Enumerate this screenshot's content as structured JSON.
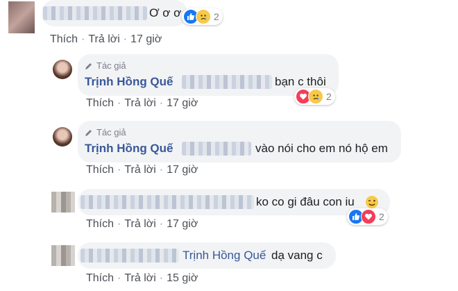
{
  "comments": [
    {
      "text": "Ơ ơ ơ",
      "reaction_count": "2",
      "reactions": [
        "like-icon",
        "sad-icon"
      ],
      "actions": {
        "like": "Thích",
        "reply": "Trả lời",
        "time": "17 giờ"
      }
    },
    {
      "badge": "Tác giả",
      "author": "Trịnh Hồng Quế",
      "text_suffix": "bạn c thôi",
      "reaction_count": "2",
      "reactions": [
        "love-icon",
        "sad-icon"
      ],
      "actions": {
        "like": "Thích",
        "reply": "Trả lời",
        "time": "17 giờ"
      }
    },
    {
      "badge": "Tác giả",
      "author": "Trịnh Hồng Quế",
      "text_suffix": "vào nói cho em nó hộ em",
      "actions": {
        "like": "Thích",
        "reply": "Trả lời",
        "time": "17 giờ"
      }
    },
    {
      "text": "ko co gi đâu con iu",
      "reaction_count": "2",
      "reactions": [
        "like-icon",
        "love-icon"
      ],
      "actions": {
        "like": "Thích",
        "reply": "Trả lời",
        "time": "17 giờ"
      }
    },
    {
      "mention": "Trịnh Hồng Quế",
      "text": "dạ vang c",
      "actions": {
        "like": "Thích",
        "reply": "Trả lời",
        "time": "15 giờ"
      }
    }
  ],
  "separator": "·",
  "colors": {
    "link": "#385898",
    "bubble": "#f2f3f5",
    "meta": "#90949c"
  }
}
